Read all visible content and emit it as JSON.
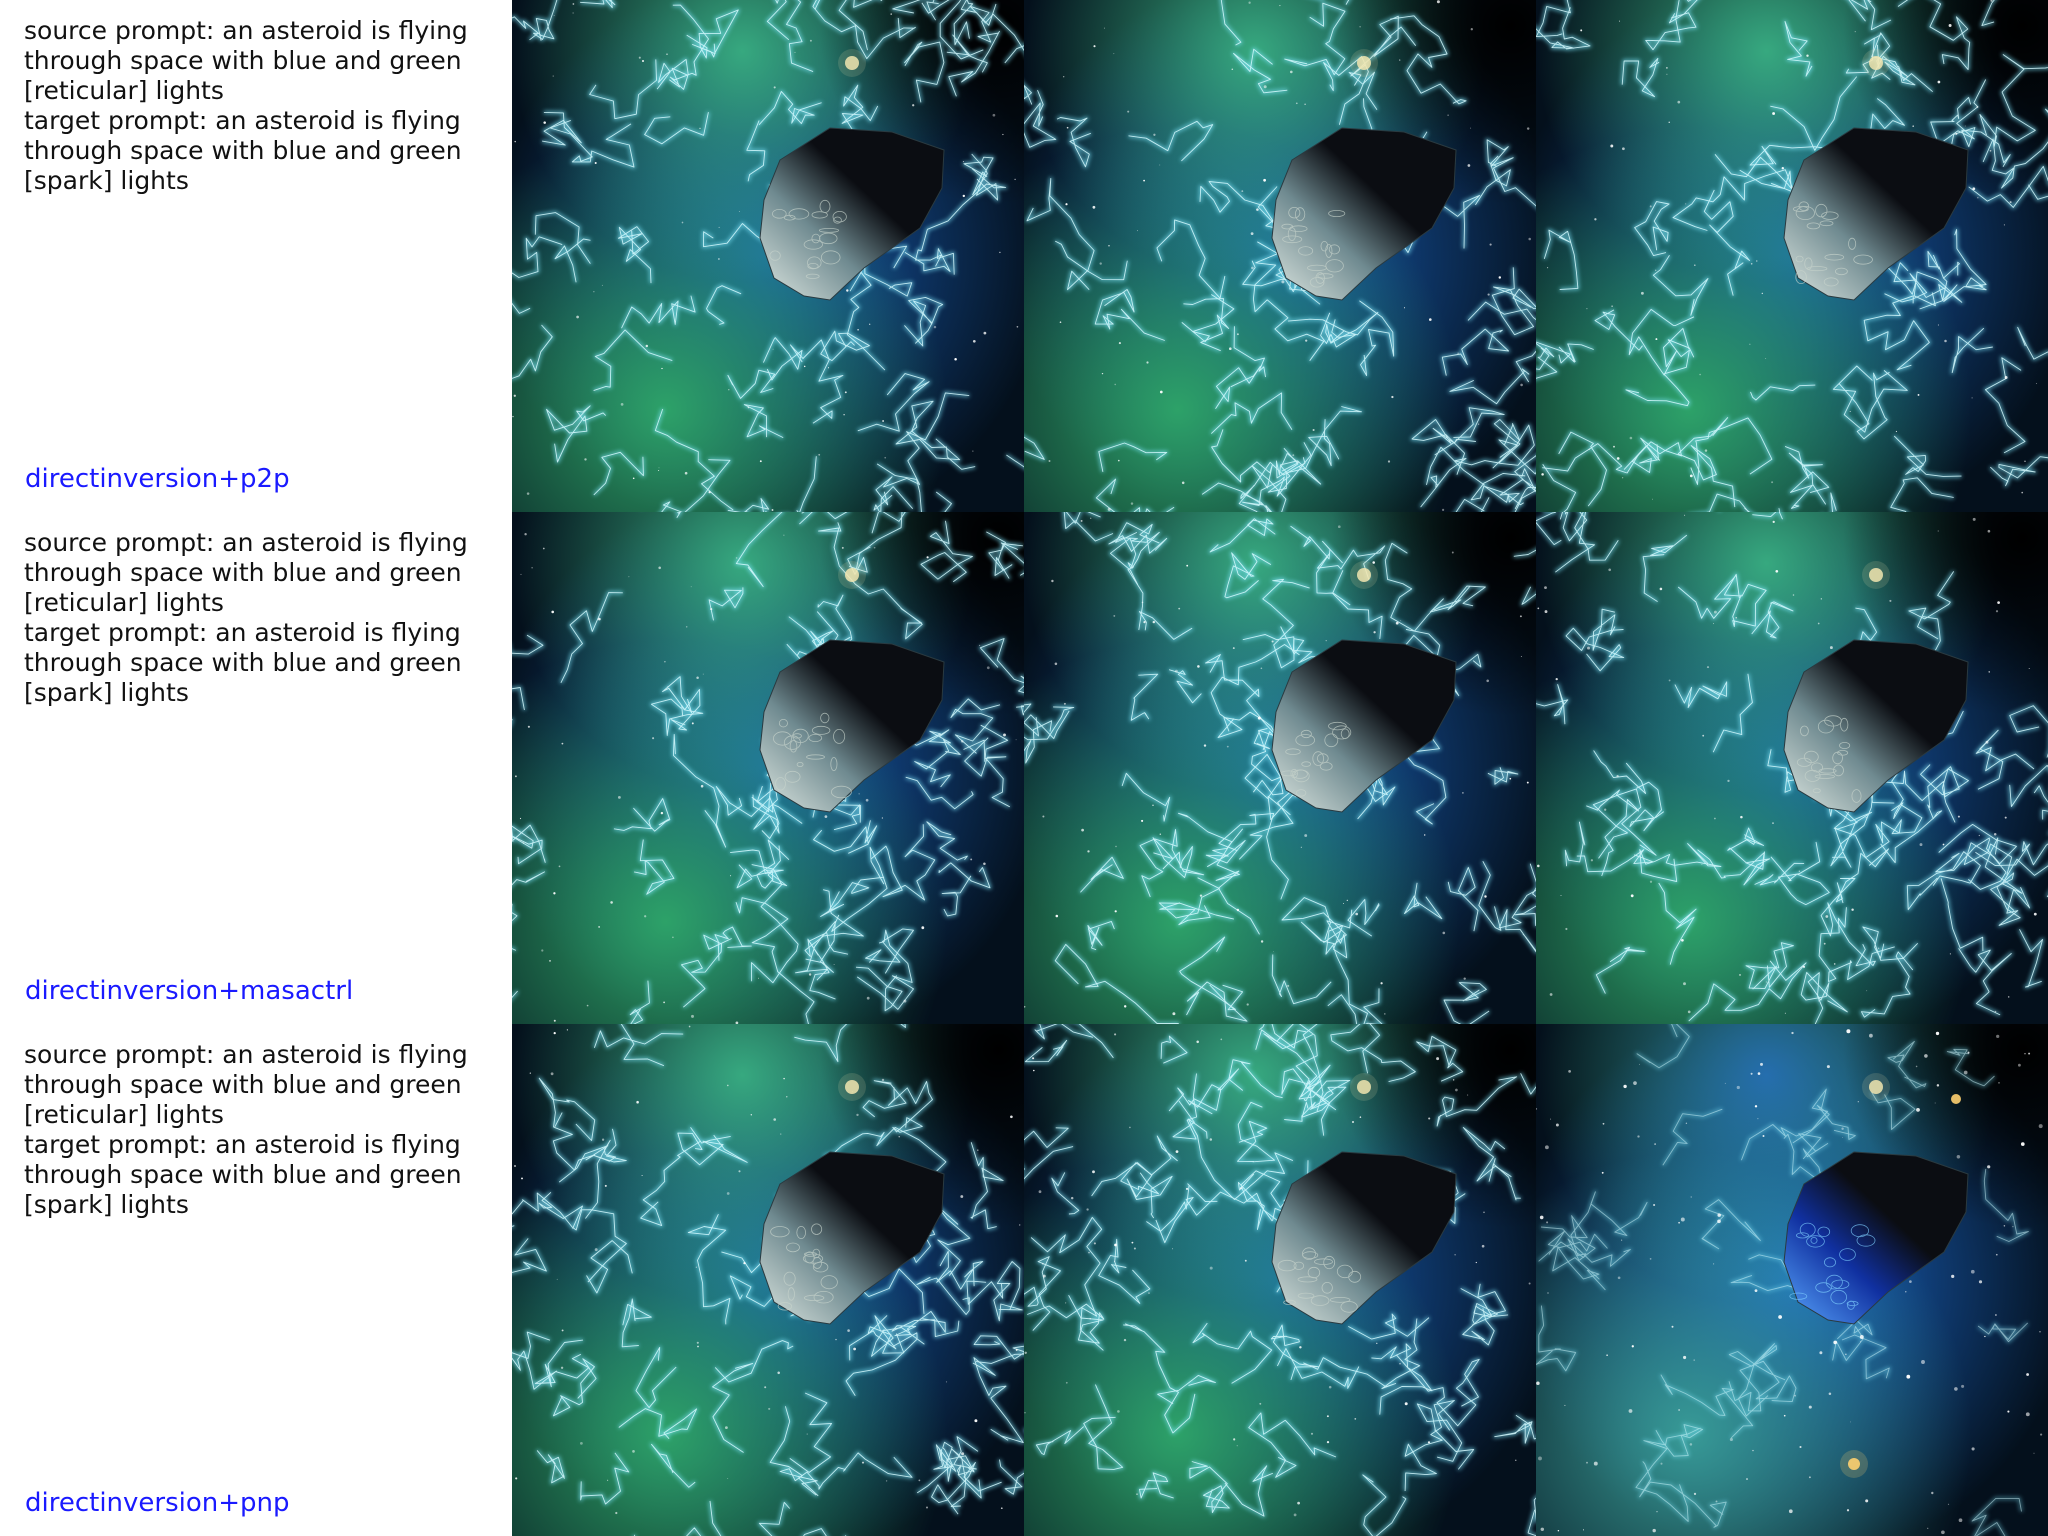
{
  "rows": [
    {
      "source_prompt": "source prompt: an asteroid is flying through space with blue and green [reticular] lights",
      "target_prompt": "target prompt: an asteroid is flying through space with blue and green [spark] lights",
      "method": "directinversion+p2p",
      "images": [
        {
          "subject": "asteroid in blue and green nebula with reticular lights",
          "variant": "source"
        },
        {
          "subject": "asteroid in blue and green nebula",
          "variant": "reconstruction"
        },
        {
          "subject": "asteroid in blue and green nebula with spark lights",
          "variant": "edited"
        }
      ]
    },
    {
      "source_prompt": "source prompt: an asteroid is flying through space with blue and green [reticular] lights",
      "target_prompt": "target prompt: an asteroid is flying through space with blue and green [spark] lights",
      "method": "directinversion+masactrl",
      "images": [
        {
          "subject": "asteroid in blue and green nebula with reticular lights",
          "variant": "source"
        },
        {
          "subject": "asteroid in blue and green nebula",
          "variant": "reconstruction"
        },
        {
          "subject": "asteroid in blue and green nebula",
          "variant": "edited"
        }
      ]
    },
    {
      "source_prompt": "source prompt: an asteroid is flying through space with blue and green [reticular] lights",
      "target_prompt": "target prompt: an asteroid is flying through space with blue and green [spark] lights",
      "method": "directinversion+pnp",
      "images": [
        {
          "subject": "asteroid in blue and green nebula with reticular lights",
          "variant": "source"
        },
        {
          "subject": "asteroid in blue and green nebula",
          "variant": "reconstruction"
        },
        {
          "subject": "asteroid in blue nebula with sparkling stars",
          "variant": "edited"
        }
      ]
    }
  ],
  "colors": {
    "method_label": "#1a1aff",
    "prompt_text": "#111111",
    "nebula_green": "#2fa86a",
    "nebula_blue": "#1a66c8",
    "lightning": "#7fe8ff",
    "space_dark": "#04101c",
    "asteroid": "#0b0d12"
  }
}
